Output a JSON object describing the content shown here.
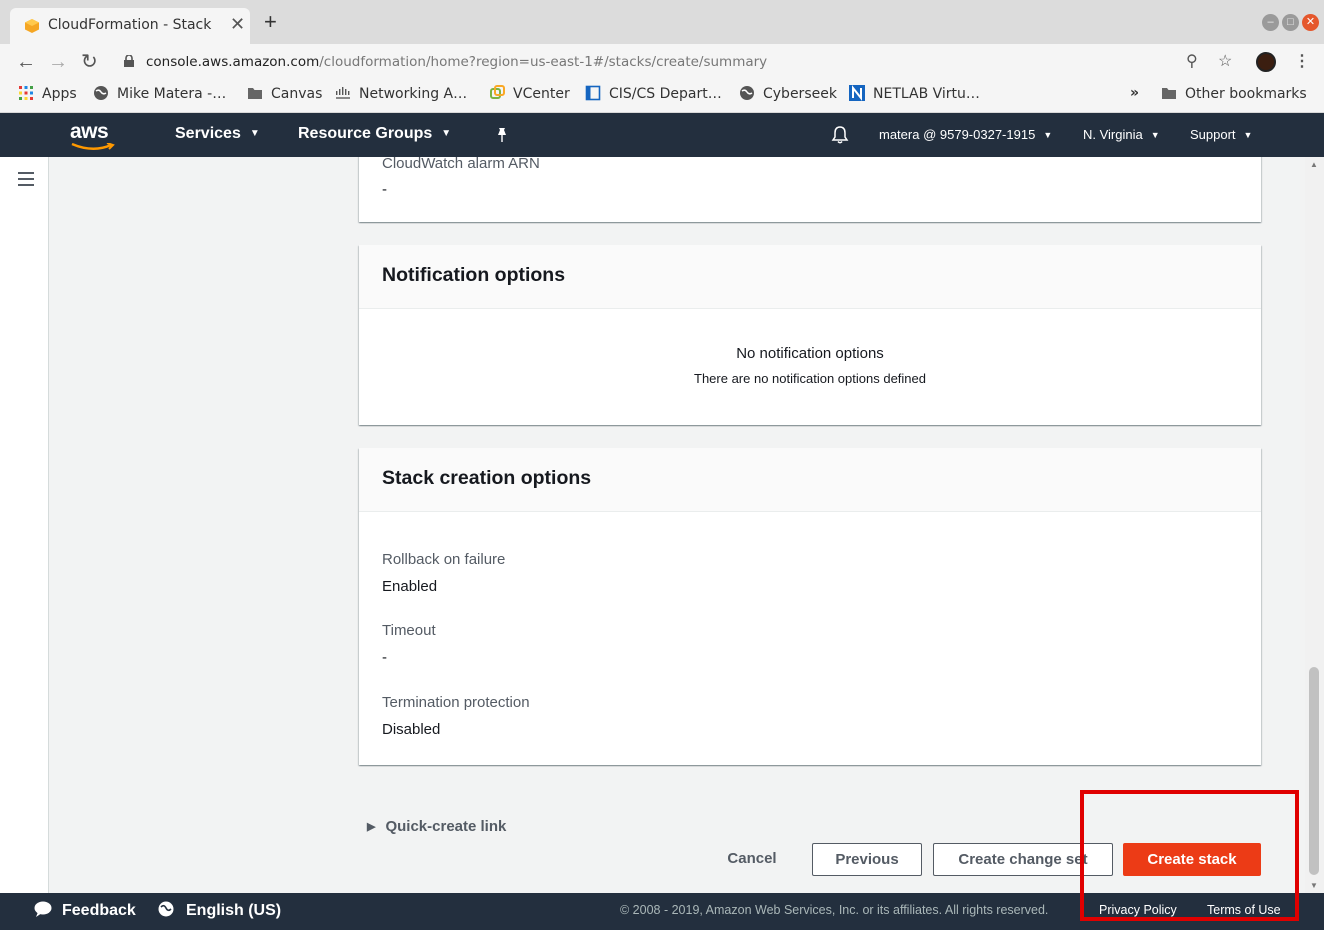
{
  "browser": {
    "tab_title": "CloudFormation - Stack",
    "tab_close": "✕",
    "new_tab": "+",
    "url_host": "console.aws.amazon.com",
    "url_path": "/cloudformation/home?region=us-east-1#/stacks/create/summary",
    "bookmarks": [
      {
        "label": "Apps",
        "icon": "apps-grid-icon"
      },
      {
        "label": "Mike Matera -…",
        "icon": "globe-icon"
      },
      {
        "label": "Canvas",
        "icon": "folder-icon"
      },
      {
        "label": "Networking A…",
        "icon": "cisco-icon"
      },
      {
        "label": "VCenter",
        "icon": "vcenter-icon"
      },
      {
        "label": "CIS/CS Depart…",
        "icon": "page-icon"
      },
      {
        "label": "Cyberseek",
        "icon": "globe-icon"
      },
      {
        "label": "NETLAB Virtu…",
        "icon": "netlab-icon"
      }
    ],
    "bookmarks_overflow": "»",
    "other_bookmarks": "Other bookmarks"
  },
  "aws_nav": {
    "logo": "aws",
    "services": "Services",
    "resource_groups": "Resource Groups",
    "account": "matera @ 9579-0327-1915",
    "region": "N. Virginia",
    "support": "Support"
  },
  "advanced": {
    "cloudwatch_label": "CloudWatch alarm ARN",
    "cloudwatch_value": "-"
  },
  "notification_panel": {
    "title": "Notification options",
    "empty_title": "No notification options",
    "empty_sub": "There are no notification options defined"
  },
  "stack_creation_panel": {
    "title": "Stack creation options",
    "fields": [
      {
        "label": "Rollback on failure",
        "value": "Enabled"
      },
      {
        "label": "Timeout",
        "value": "-"
      },
      {
        "label": "Termination protection",
        "value": "Disabled"
      }
    ]
  },
  "quick_create_link": "Quick-create link",
  "actions": {
    "cancel": "Cancel",
    "previous": "Previous",
    "create_change_set": "Create change set",
    "create_stack": "Create stack"
  },
  "footer": {
    "feedback": "Feedback",
    "language": "English (US)",
    "copyright": "© 2008 - 2019, Amazon Web Services, Inc. or its affiliates. All rights reserved.",
    "privacy": "Privacy Policy",
    "terms": "Terms of Use"
  },
  "colors": {
    "primary_button": "#ec3b16",
    "aws_nav_bg": "#232f3e",
    "highlight": "#e00000"
  }
}
